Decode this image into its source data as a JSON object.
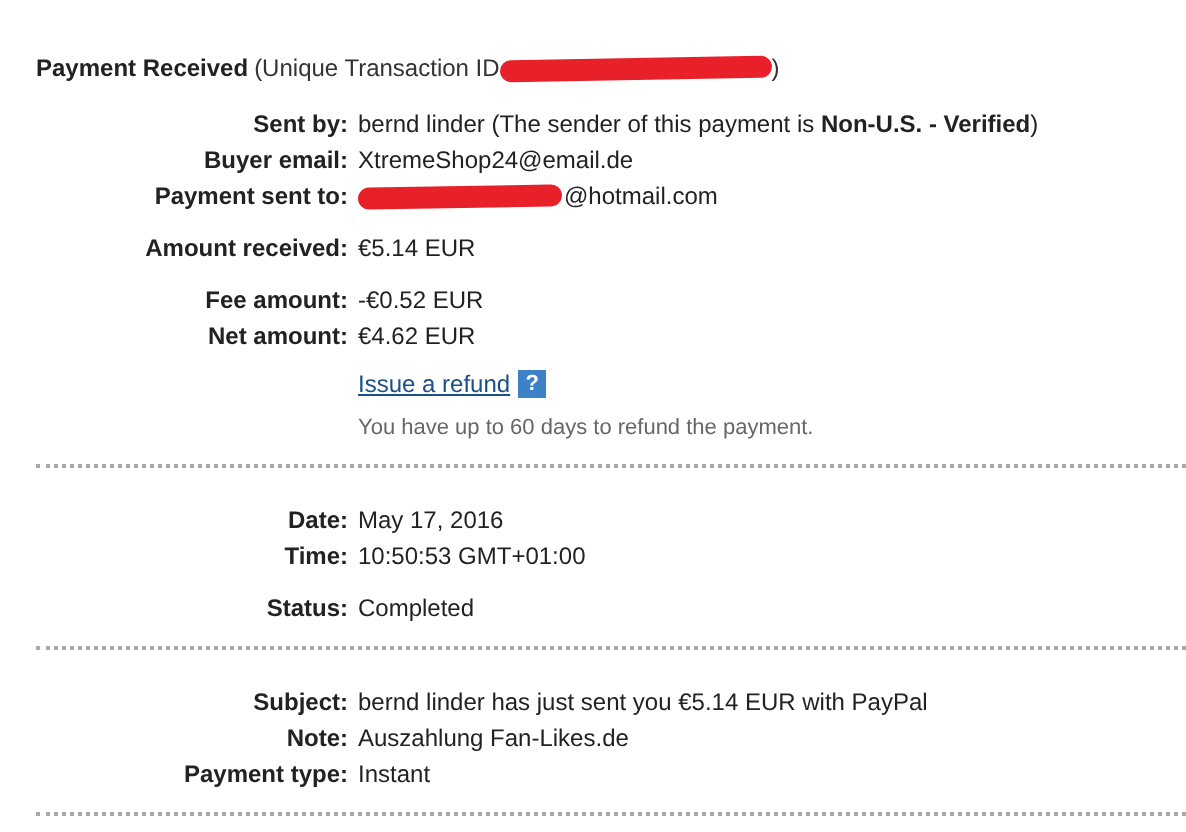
{
  "header": {
    "title": "Payment Received",
    "detail_open": "(Unique Transaction ID",
    "detail_redacted": true,
    "detail_close": ")"
  },
  "sections": [
    {
      "groups": [
        [
          {
            "label": "Sent by:",
            "value": "bernd linder (The sender of this payment is **Non-U.S. - Verified**)"
          },
          {
            "label": "Buyer email:",
            "value": "XtremeShop24@email.de"
          },
          {
            "label": "Payment sent to:",
            "value": "@hotmail.com",
            "redacted": true
          }
        ],
        [
          {
            "label": "Amount received:",
            "value": "€5.14 EUR"
          }
        ],
        [
          {
            "label": "Fee amount:",
            "value": "-€0.52 EUR"
          },
          {
            "label": "Net amount:",
            "value": "€4.62 EUR"
          }
        ]
      ],
      "refund": {
        "link": "Issue a refund",
        "help": "?",
        "note": "You have up to 60 days to refund the payment."
      }
    },
    {
      "groups": [
        [
          {
            "label": "Date:",
            "value": "May 17, 2016"
          },
          {
            "label": "Time:",
            "value": "10:50:53 GMT+01:00"
          }
        ],
        [
          {
            "label": "Status:",
            "value": "Completed"
          }
        ]
      ]
    },
    {
      "groups": [
        [
          {
            "label": "Subject:",
            "value": "bernd linder has just sent you €5.14 EUR with PayPal"
          },
          {
            "label": "Note:",
            "value": "Auszahlung Fan-Likes.de"
          },
          {
            "label": "Payment type:",
            "value": "Instant"
          }
        ]
      ]
    }
  ]
}
